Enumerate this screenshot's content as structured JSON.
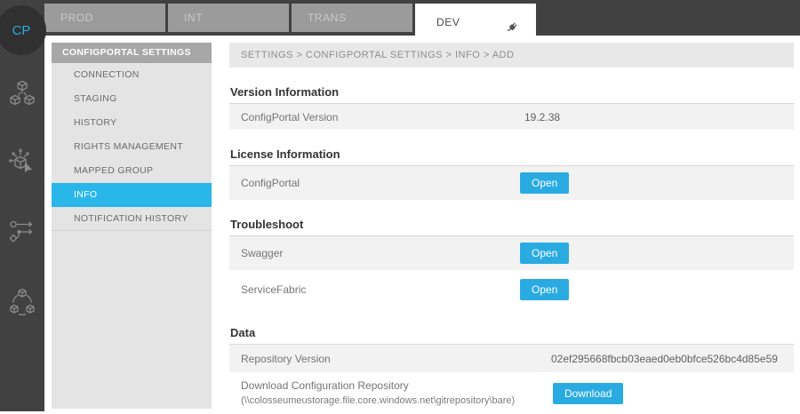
{
  "avatar": {
    "initials": "CP"
  },
  "topbar": {
    "tabs": [
      {
        "label": "PROD",
        "active": false
      },
      {
        "label": "INT",
        "active": false
      },
      {
        "label": "TRANS",
        "active": false
      },
      {
        "label": "DEV",
        "active": true
      }
    ]
  },
  "rail_icons": [
    "packages-icon",
    "configure-touch-icon",
    "workflow-icon",
    "cluster-sync-icon"
  ],
  "sidebar": {
    "header": "CONFIGPORTAL SETTINGS",
    "items": [
      {
        "label": "CONNECTION",
        "selected": false
      },
      {
        "label": "STAGING",
        "selected": false
      },
      {
        "label": "HISTORY",
        "selected": false
      },
      {
        "label": "RIGHTS MANAGEMENT",
        "selected": false
      },
      {
        "label": "MAPPED GROUP",
        "selected": false
      },
      {
        "label": "INFO",
        "selected": true
      },
      {
        "label": "NOTIFICATION HISTORY",
        "selected": false
      }
    ]
  },
  "breadcrumb": "SETTINGS > CONFIGPORTAL SETTINGS > INFO > ADD",
  "sections": [
    {
      "title": "Version Information",
      "rows": [
        {
          "label": "ConfigPortal Version",
          "value": "19.2.38"
        }
      ]
    },
    {
      "title": "License Information",
      "rows": [
        {
          "label": "ConfigPortal",
          "button": "Open"
        }
      ]
    },
    {
      "title": "Troubleshoot",
      "rows": [
        {
          "label": "Swagger",
          "button": "Open"
        },
        {
          "label": "ServiceFabric",
          "button": "Open"
        }
      ]
    },
    {
      "title": "Data",
      "rows": [
        {
          "label": "Repository Version",
          "value": "02ef295668fbcb03eaed0eb0bfce526bc4d85e59"
        },
        {
          "label": "Download Configuration Repository",
          "sublabel": "(\\\\colosseumeustorage.file.core.windows.net\\gitrepository\\bare)",
          "button": "Download"
        }
      ]
    }
  ],
  "colors": {
    "accent": "#29abe2",
    "selected_item": "#29b7ea",
    "rail": "#414141",
    "tab_inactive": "#9b9b9b"
  }
}
